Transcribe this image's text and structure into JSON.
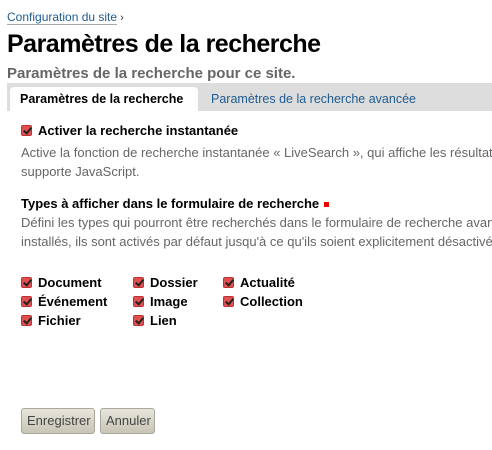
{
  "breadcrumb": {
    "link": "Configuration du site",
    "separator": "›"
  },
  "title": "Paramètres de la recherche",
  "subtitle": "Paramètres de la recherche pour ce site.",
  "tabs": [
    {
      "label": "Paramètres de la recherche",
      "active": true
    },
    {
      "label": "Paramètres de la recherche avancée",
      "active": false
    }
  ],
  "livesearch": {
    "label": "Activer la recherche instantanée",
    "checked": true,
    "description": [
      "Active la fonction de recherche instantanée « LiveSearch », qui affiche les résultats",
      "supporte JavaScript."
    ]
  },
  "types": {
    "label": "Types à afficher dans le formulaire de recherche",
    "required": true,
    "description": [
      "Défini les types qui pourront être recherchés dans le formulaire de recherche avancé",
      "installés, ils sont activés par défaut jusqu'à ce qu'ils soient explicitement désactivés"
    ],
    "items": [
      {
        "label": "Document",
        "checked": true
      },
      {
        "label": "Dossier",
        "checked": true
      },
      {
        "label": "Actualité",
        "checked": true
      },
      {
        "label": "Événement",
        "checked": true
      },
      {
        "label": "Image",
        "checked": true
      },
      {
        "label": "Collection",
        "checked": true
      },
      {
        "label": "Fichier",
        "checked": true
      },
      {
        "label": "Lien",
        "checked": true
      }
    ]
  },
  "buttons": {
    "save": "Enregistrer",
    "cancel": "Annuler"
  },
  "colors": {
    "link": "#205c90",
    "checkbox": "#e05050",
    "required": "#ee0000"
  }
}
